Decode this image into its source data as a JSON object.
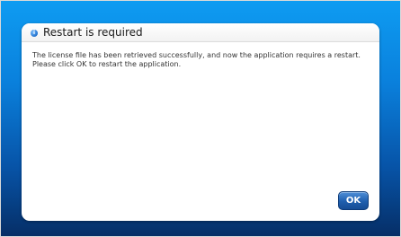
{
  "dialog": {
    "title": "Restart is required",
    "title_icon": "info-icon",
    "message_lines": [
      "The license file has been retrieved successfully, and now the application requires a restart.",
      "Please click OK to restart the application."
    ],
    "ok_label": "OK"
  },
  "colors": {
    "background_top": "#0e9cf2",
    "background_bottom": "#062e66",
    "button": "#1f5fae"
  }
}
